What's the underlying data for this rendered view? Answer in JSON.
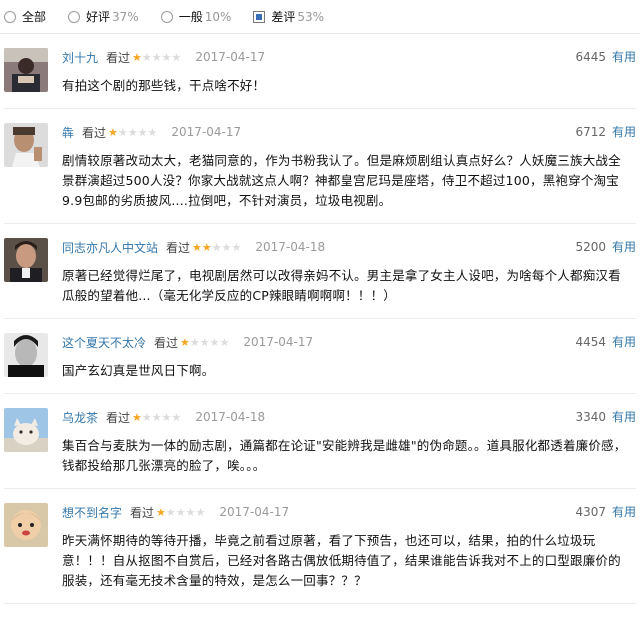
{
  "filters": [
    {
      "label": "全部",
      "pct": "",
      "control": "radio",
      "selected": false
    },
    {
      "label": "好评",
      "pct": "37%",
      "control": "radio",
      "selected": false
    },
    {
      "label": "一般",
      "pct": "10%",
      "control": "radio",
      "selected": false
    },
    {
      "label": "差评",
      "pct": "53%",
      "control": "checkbox",
      "selected": true
    }
  ],
  "reviews": [
    {
      "author": "刘十九",
      "watched": "看过",
      "rating": 1,
      "date": "2017-04-17",
      "votes": "6445",
      "useful": "有用",
      "text": "有拍这个剧的那些钱，干点啥不好！"
    },
    {
      "author": "犇",
      "watched": "看过",
      "rating": 1,
      "date": "2017-04-17",
      "votes": "6712",
      "useful": "有用",
      "text": "剧情较原著改动太大，老猫同意的，作为书粉我认了。但是麻烦剧组认真点好么？人妖魔三族大战全景群演超过500人没？你家大战就这点人啊？神都皇宫尼玛是座塔，侍卫不超过100，黑袍穿个淘宝9.9包邮的劣质披风....拉倒吧，不针对演员，垃圾电视剧。"
    },
    {
      "author": "同志亦凡人中文站",
      "watched": "看过",
      "rating": 2,
      "date": "2017-04-18",
      "votes": "5200",
      "useful": "有用",
      "text": "原著已经觉得烂尾了，电视剧居然可以改得亲妈不认。男主是拿了女主人设吧，为啥每个人都痴汉看瓜般的望着他...（毫无化学反应的CP辣眼睛啊啊啊！！！）"
    },
    {
      "author": "这个夏天不太冷",
      "watched": "看过",
      "rating": 1,
      "date": "2017-04-17",
      "votes": "4454",
      "useful": "有用",
      "text": "国产玄幻真是世风日下啊。"
    },
    {
      "author": "乌龙茶",
      "watched": "看过",
      "rating": 1,
      "date": "2017-04-18",
      "votes": "3340",
      "useful": "有用",
      "text": "集百合与麦肤为一体的励志剧，通篇都在论证\"安能辨我是雌雄\"的伪命题。。道具服化都透着廉价感，钱都投给那几张漂亮的脸了，唉。。。"
    },
    {
      "author": "想不到名字",
      "watched": "看过",
      "rating": 1,
      "date": "2017-04-17",
      "votes": "4307",
      "useful": "有用",
      "text": "昨天满怀期待的等待开播，毕竟之前看过原著，看了下预告，也还可以，结果，拍的什么垃圾玩意！！！自从抠图不自赏后，已经对各路古偶放低期待值了，结果谁能告诉我对不上的口型跟廉价的服装，还有毫无技术含量的特效，是怎么一回事？？？"
    }
  ],
  "colors": {
    "link": "#3377aa",
    "star": "#f5a623",
    "star_off": "#dcdcdc",
    "date": "#9a9a9a"
  }
}
